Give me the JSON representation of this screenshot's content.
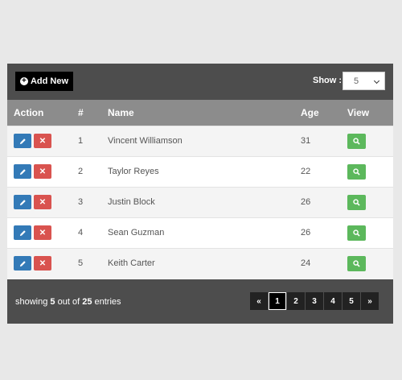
{
  "toolbar": {
    "add_label": "Add New",
    "show_label": "Show :",
    "page_size": "5"
  },
  "table": {
    "headers": {
      "action": "Action",
      "num": "#",
      "name": "Name",
      "age": "Age",
      "view": "View"
    },
    "rows": [
      {
        "num": "1",
        "name": "Vincent Williamson",
        "age": "31"
      },
      {
        "num": "2",
        "name": "Taylor Reyes",
        "age": "22"
      },
      {
        "num": "3",
        "name": "Justin Block",
        "age": "26"
      },
      {
        "num": "4",
        "name": "Sean Guzman",
        "age": "26"
      },
      {
        "num": "5",
        "name": "Keith Carter",
        "age": "24"
      }
    ]
  },
  "footer": {
    "prefix": "showing",
    "shown": "5",
    "middle": "out of",
    "total": "25",
    "suffix": "entries"
  },
  "pagination": {
    "prev": "«",
    "pages": [
      "1",
      "2",
      "3",
      "4",
      "5"
    ],
    "next": "»",
    "active": "1"
  },
  "icons": {
    "add": "plus-circle-icon",
    "edit": "pencil-icon",
    "delete": "times-icon",
    "view": "search-icon"
  },
  "colors": {
    "bar": "#4d4d4d",
    "header": "#8c8c8c",
    "edit": "#337ab7",
    "delete": "#d9534f",
    "view": "#5cb85c"
  }
}
